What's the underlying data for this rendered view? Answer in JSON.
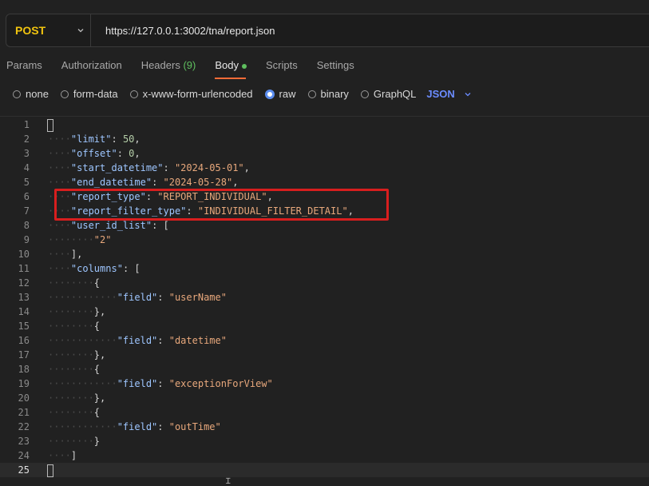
{
  "request": {
    "method": "POST",
    "url": "https://127.0.0.1:3002/tna/report.json"
  },
  "tabs": [
    {
      "label": "Params"
    },
    {
      "label": "Authorization"
    },
    {
      "label": "Headers",
      "count": "(9)"
    },
    {
      "label": "Body"
    },
    {
      "label": "Scripts"
    },
    {
      "label": "Settings"
    }
  ],
  "body_options": [
    {
      "label": "none"
    },
    {
      "label": "form-data"
    },
    {
      "label": "x-www-form-urlencoded"
    },
    {
      "label": "raw",
      "selected": true
    },
    {
      "label": "binary"
    },
    {
      "label": "GraphQL"
    }
  ],
  "language": "JSON",
  "editor": {
    "line_numbers": [
      "1",
      "2",
      "3",
      "4",
      "5",
      "6",
      "7",
      "8",
      "9",
      "10",
      "11",
      "12",
      "13",
      "14",
      "15",
      "16",
      "17",
      "18",
      "19",
      "20",
      "21",
      "22",
      "23",
      "24",
      "25"
    ],
    "limit_key": "\"limit\"",
    "limit_val": "50",
    "offset_key": "\"offset\"",
    "offset_val": "0",
    "start_key": "\"start_datetime\"",
    "start_val": "\"2024-05-01\"",
    "end_key": "\"end_datetime\"",
    "end_val": "\"2024-05-28\"",
    "report_type_key": "\"report_type\"",
    "report_type_val": "\"REPORT_INDIVIDUAL\"",
    "report_filter_key": "\"report_filter_type\"",
    "report_filter_val": "\"INDIVIDUAL_FILTER_DETAIL\"",
    "user_id_list_key": "\"user_id_list\"",
    "user_id_val": "\"2\"",
    "columns_key": "\"columns\"",
    "field_key": "\"field\"",
    "field_values": [
      "\"userName\"",
      "\"datetime\"",
      "\"exceptionForView\"",
      "\"outTime\""
    ]
  },
  "colors": {
    "method": "#f1c40f",
    "accent_tab": "#ff6c37",
    "json_lang": "#6b8cff",
    "highlight_box": "#d81e1e"
  }
}
